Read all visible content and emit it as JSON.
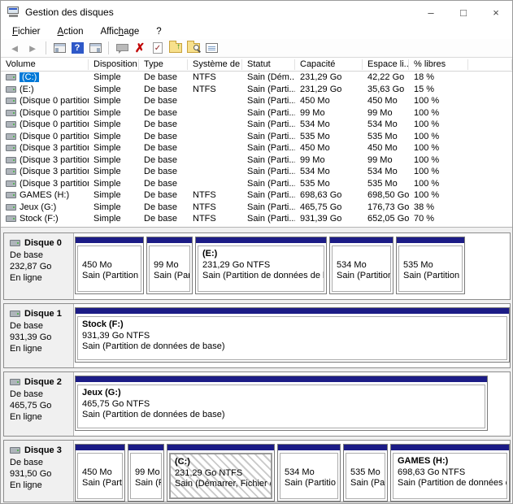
{
  "window": {
    "title": "Gestion des disques",
    "controls": {
      "minimize": "–",
      "maximize": "□",
      "close": "×"
    }
  },
  "menu": {
    "items": [
      {
        "pre": "",
        "key": "F",
        "post": "ichier"
      },
      {
        "pre": "",
        "key": "A",
        "post": "ction"
      },
      {
        "pre": "Affic",
        "key": "h",
        "post": "age"
      },
      {
        "pre": "",
        "key": "",
        "post": "?"
      }
    ]
  },
  "toolbar": {
    "back_glyph": "◄",
    "forward_glyph": "►",
    "help_glyph": "?",
    "delete_glyph": "✗",
    "check_glyph": "✓",
    "icons": [
      "back",
      "forward",
      "console-tree",
      "help",
      "action-pane",
      "popup",
      "delete-volume",
      "check-document",
      "folder-open",
      "folder-explore",
      "properties-list"
    ]
  },
  "table": {
    "columns": [
      "Volume",
      "Disposition",
      "Type",
      "Système de ...",
      "Statut",
      "Capacité",
      "Espace li...",
      "% libres"
    ],
    "rows": [
      {
        "volume": "(C:)",
        "disposition": "Simple",
        "type": "De base",
        "fs": "NTFS",
        "status": "Sain (Dém...",
        "capacity": "231,29 Go",
        "free": "42,22 Go",
        "pct": "18 %"
      },
      {
        "volume": "(E:)",
        "disposition": "Simple",
        "type": "De base",
        "fs": "NTFS",
        "status": "Sain (Parti...",
        "capacity": "231,29 Go",
        "free": "35,63 Go",
        "pct": "15 %"
      },
      {
        "volume": "(Disque 0 partition...",
        "disposition": "Simple",
        "type": "De base",
        "fs": "",
        "status": "Sain (Parti...",
        "capacity": "450 Mo",
        "free": "450 Mo",
        "pct": "100 %"
      },
      {
        "volume": "(Disque 0 partition...",
        "disposition": "Simple",
        "type": "De base",
        "fs": "",
        "status": "Sain (Parti...",
        "capacity": "99 Mo",
        "free": "99 Mo",
        "pct": "100 %"
      },
      {
        "volume": "(Disque 0 partition...",
        "disposition": "Simple",
        "type": "De base",
        "fs": "",
        "status": "Sain (Parti...",
        "capacity": "534 Mo",
        "free": "534 Mo",
        "pct": "100 %"
      },
      {
        "volume": "(Disque 0 partition...",
        "disposition": "Simple",
        "type": "De base",
        "fs": "",
        "status": "Sain (Parti...",
        "capacity": "535 Mo",
        "free": "535 Mo",
        "pct": "100 %"
      },
      {
        "volume": "(Disque 3 partition...",
        "disposition": "Simple",
        "type": "De base",
        "fs": "",
        "status": "Sain (Parti...",
        "capacity": "450 Mo",
        "free": "450 Mo",
        "pct": "100 %"
      },
      {
        "volume": "(Disque 3 partition...",
        "disposition": "Simple",
        "type": "De base",
        "fs": "",
        "status": "Sain (Parti...",
        "capacity": "99 Mo",
        "free": "99 Mo",
        "pct": "100 %"
      },
      {
        "volume": "(Disque 3 partition...",
        "disposition": "Simple",
        "type": "De base",
        "fs": "",
        "status": "Sain (Parti...",
        "capacity": "534 Mo",
        "free": "534 Mo",
        "pct": "100 %"
      },
      {
        "volume": "(Disque 3 partition...",
        "disposition": "Simple",
        "type": "De base",
        "fs": "",
        "status": "Sain (Parti...",
        "capacity": "535 Mo",
        "free": "535 Mo",
        "pct": "100 %"
      },
      {
        "volume": "GAMES (H:)",
        "disposition": "Simple",
        "type": "De base",
        "fs": "NTFS",
        "status": "Sain (Parti...",
        "capacity": "698,63 Go",
        "free": "698,50 Go",
        "pct": "100 %"
      },
      {
        "volume": "Jeux (G:)",
        "disposition": "Simple",
        "type": "De base",
        "fs": "NTFS",
        "status": "Sain (Parti...",
        "capacity": "465,75 Go",
        "free": "176,73 Go",
        "pct": "38 %"
      },
      {
        "volume": "Stock (F:)",
        "disposition": "Simple",
        "type": "De base",
        "fs": "NTFS",
        "status": "Sain (Parti...",
        "capacity": "931,39 Go",
        "free": "652,05 Go",
        "pct": "70 %"
      }
    ]
  },
  "disks": [
    {
      "name": "Disque 0",
      "type": "De base",
      "size": "232,87 Go",
      "status": "En ligne",
      "partitions": [
        {
          "name": "",
          "size": "450 Mo",
          "status": "Sain (Partition c"
        },
        {
          "name": "",
          "size": "99 Mo",
          "status": "Sain (Partit"
        },
        {
          "name": "(E:)",
          "size": "231,29 Go NTFS",
          "status": "Sain (Partition de données de base)"
        },
        {
          "name": "",
          "size": "534 Mo",
          "status": "Sain (Partition d"
        },
        {
          "name": "",
          "size": "535 Mo",
          "status": "Sain (Partition de"
        }
      ]
    },
    {
      "name": "Disque 1",
      "type": "De base",
      "size": "931,39 Go",
      "status": "En ligne",
      "partitions": [
        {
          "name": "Stock  (F:)",
          "size": "931,39 Go NTFS",
          "status": "Sain (Partition de données de base)"
        }
      ]
    },
    {
      "name": "Disque 2",
      "type": "De base",
      "size": "465,75 Go",
      "status": "En ligne",
      "partitions": [
        {
          "name": "Jeux  (G:)",
          "size": "465,75 Go NTFS",
          "status": "Sain (Partition de données de base)"
        }
      ]
    },
    {
      "name": "Disque 3",
      "type": "De base",
      "size": "931,50 Go",
      "status": "En ligne",
      "partitions": [
        {
          "name": "",
          "size": "450 Mo",
          "status": "Sain (Partitio"
        },
        {
          "name": "",
          "size": "99 Mo",
          "status": "Sain (Par"
        },
        {
          "name": "(C:)",
          "size": "231,29 Go NTFS",
          "status": "Sain (Démarrer, Fichier d'éc"
        },
        {
          "name": "",
          "size": "534 Mo",
          "status": "Sain (Partitio"
        },
        {
          "name": "",
          "size": "535 Mo",
          "status": "Sain (Partitio"
        },
        {
          "name": "GAMES  (H:)",
          "size": "698,63 Go NTFS",
          "status": "Sain (Partition de données de b"
        }
      ]
    }
  ]
}
